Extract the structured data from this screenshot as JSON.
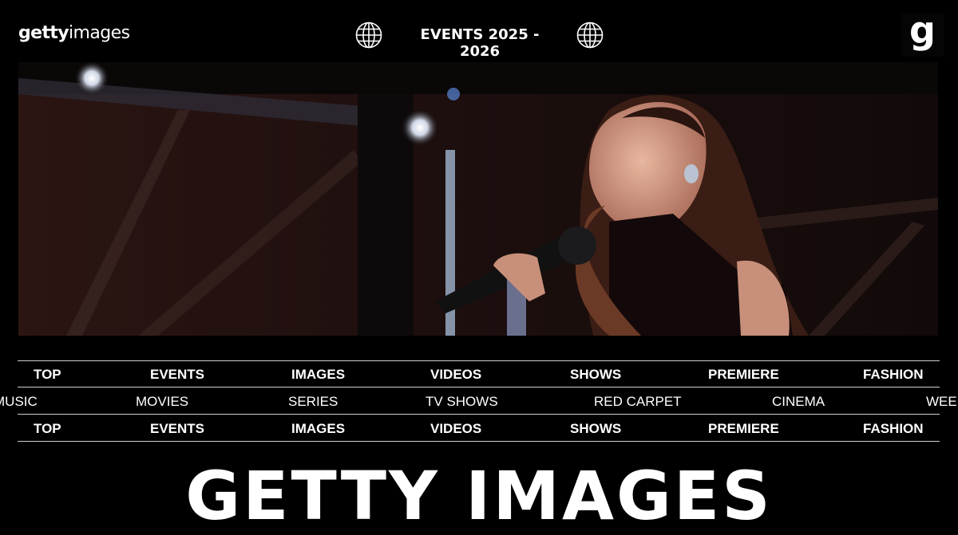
{
  "header": {
    "logo_bold": "getty",
    "logo_light": "images",
    "title": "EVENTS 2025 - 2026",
    "left_icon": "globe-icon",
    "right_icon": "globe-icon",
    "brand_letter": "g"
  },
  "hero": {
    "subject": "performer-singing-photo"
  },
  "nav_top": [
    "TOP",
    "EVENTS",
    "IMAGES",
    "VIDEOS",
    "SHOWS",
    "PREMIERE",
    "FASHION"
  ],
  "nav_middle": [
    "MUSIC",
    "MOVIES",
    "SERIES",
    "TV SHOWS",
    "RED CARPET",
    "CINEMA",
    "WEEK"
  ],
  "nav_bottom": [
    "TOP",
    "EVENTS",
    "IMAGES",
    "VIDEOS",
    "SHOWS",
    "PREMIERE",
    "FASHION"
  ],
  "big_title": "GETTY IMAGES",
  "colors": {
    "background": "#000000",
    "text": "#ffffff",
    "rule": "#cfcfcf"
  }
}
